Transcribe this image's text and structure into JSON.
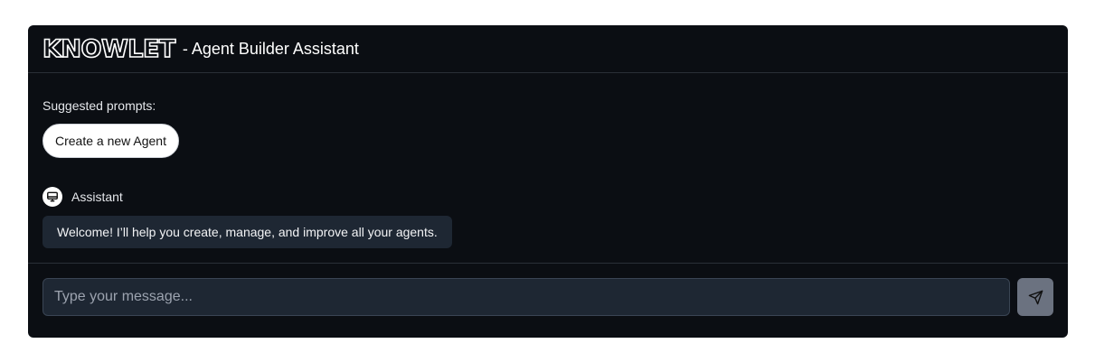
{
  "header": {
    "logo_text": "KNOWLET",
    "title": "- Agent Builder Assistant"
  },
  "suggestions": {
    "label": "Suggested prompts:",
    "items": [
      "Create a new Agent"
    ]
  },
  "messages": [
    {
      "sender": "Assistant",
      "avatar_icon": "monitor-icon",
      "text": "Welcome! I’ll help you create, manage, and improve all your agents."
    }
  ],
  "composer": {
    "placeholder": "Type your message...",
    "value": "",
    "send_icon": "send-icon"
  },
  "colors": {
    "panel_bg": "#0b0e13",
    "bubble_bg": "#1e2733",
    "send_button_bg": "#6b7280"
  }
}
